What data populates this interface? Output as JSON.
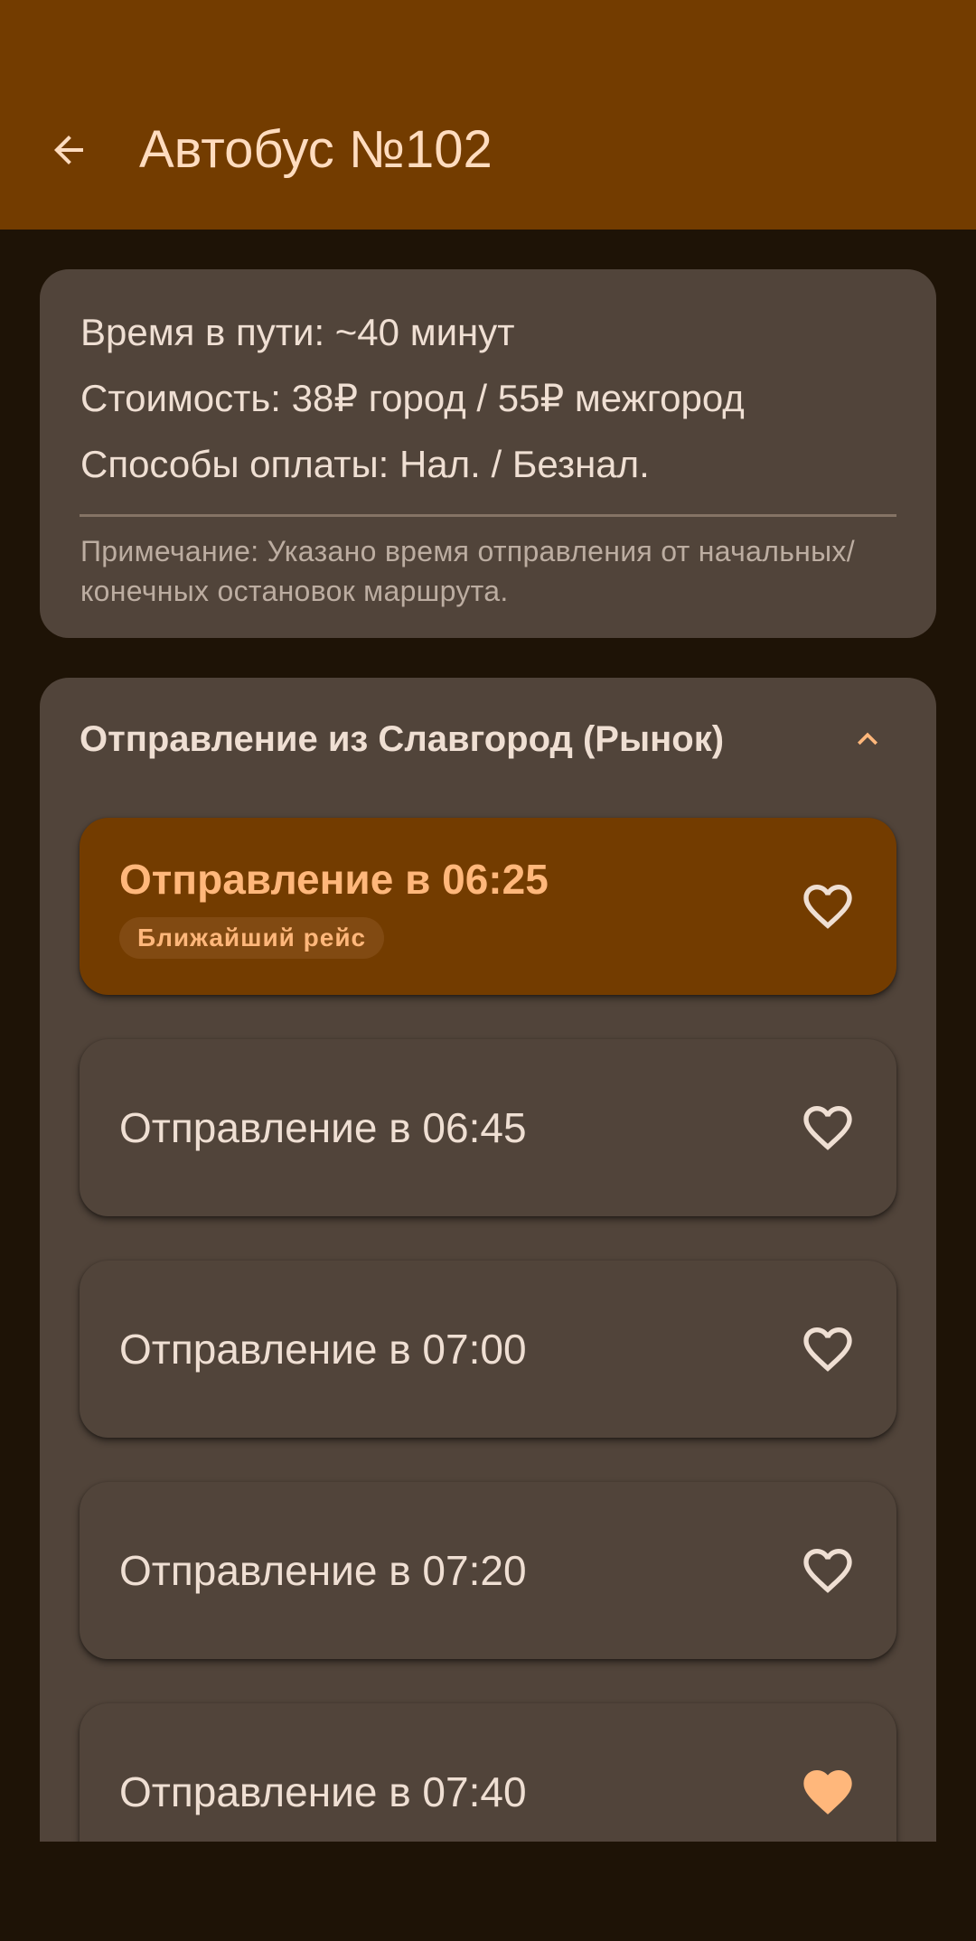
{
  "appbar": {
    "title": "Автобус №102",
    "back_icon": "arrow-left-icon"
  },
  "info": {
    "travel_time": "Время в пути: ~40 минут",
    "cost": "Стоимость: 38₽ город / 55₽ межгород",
    "payment": "Способы оплаты: Нал. / Безнал.",
    "note": "Примечание: Указано время отправления от начальных/конечных остановок маршрута."
  },
  "section": {
    "title": "Отправление из Славгород (Рынок)",
    "collapse_icon": "chevron-up-icon"
  },
  "trips": [
    {
      "label": "Отправление в 06:25",
      "badge": "Ближайший рейс",
      "favorite": false,
      "highlight": true
    },
    {
      "label": "Отправление в 06:45",
      "favorite": false
    },
    {
      "label": "Отправление в 07:00",
      "favorite": false
    },
    {
      "label": "Отправление в 07:20",
      "favorite": false
    },
    {
      "label": "Отправление в 07:40",
      "favorite": true
    }
  ],
  "colors": {
    "appbar": "#733c00",
    "background": "#1e1306",
    "card": "#51443a",
    "accent": "#ffb77b",
    "text": "#efdfd3",
    "heart_outline": "#efdfd3",
    "heart_filled": "#ffb77b"
  }
}
